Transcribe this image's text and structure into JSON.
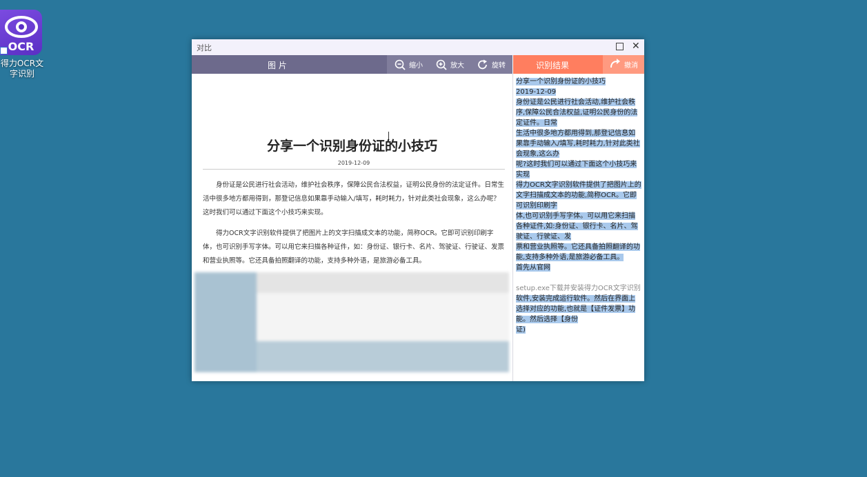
{
  "desktop": {
    "shortcut_label": "得力OCR文字识别",
    "icon_text": "OCR"
  },
  "window": {
    "title": "对比",
    "left_panel": {
      "header": "图 片",
      "tools": [
        {
          "label": "缩小",
          "icon": "zoom-out-icon"
        },
        {
          "label": "放大",
          "icon": "zoom-in-icon"
        },
        {
          "label": "旋转",
          "icon": "rotate-icon"
        }
      ]
    },
    "right_panel": {
      "header": "识别结果",
      "undo_label": "撤消"
    }
  },
  "document_image": {
    "title": "分享一个识别身份证的小技巧",
    "date": "2019-12-09",
    "paragraphs": [
      "身份证是公民进行社会活动，维护社会秩序，保障公民合法权益，证明公民身份的法定证件。日常生活中很多地方都用得到，那登记信息如果靠手动输入/填写，耗时耗力，针对此类社会现象，这么办呢？这时我们可以通过下面这个小技巧来实现。",
      "得力OCR文字识别软件提供了把图片上的文字扫描成文本的功能，简称OCR。它即可识别印刷字体，也可识别手写字体。可以用它来扫描各种证件，如：身份证、银行卡、名片、驾驶证、行驶证、发票和营业执照等。它还具备拍照翻译的功能，支持多种外语，是旅游必备工具。"
    ]
  },
  "ocr_result": {
    "lines": [
      "分享一个识别身份证的小技巧",
      "2019-12-09",
      "身份证是公民进行社会活动,维护社会秩序,保障公民合法权益,证明公民身份的法定证件。日常",
      "生活中很多地方都用得到,那登记信息如果靠手动输入/填写,耗时耗力,针对此类社会现象,这么办",
      "呢?这时我们可以通过下面这个小技巧来实现",
      "得力OCR文字识别软件提供了把图片上的文字扫描成文本的功能,简称OCR。它即可识别印刷字",
      "体,也可识别手写字体。可以用它来扫描各种证件,如:身份证、银行卡、名片、驾驶证、行驶证、发",
      "票和营业执照等。它还具备拍照翻译的功能,支持多种外语,是旅游必备工具。",
      "首先从官网",
      "setup.exe下载并安装得力OCR文字识别",
      "软件,安装完成运行软件。然后在界面上选择对应的功能,也就是【证件发票】功能。然后选择【身份",
      "证)"
    ]
  }
}
